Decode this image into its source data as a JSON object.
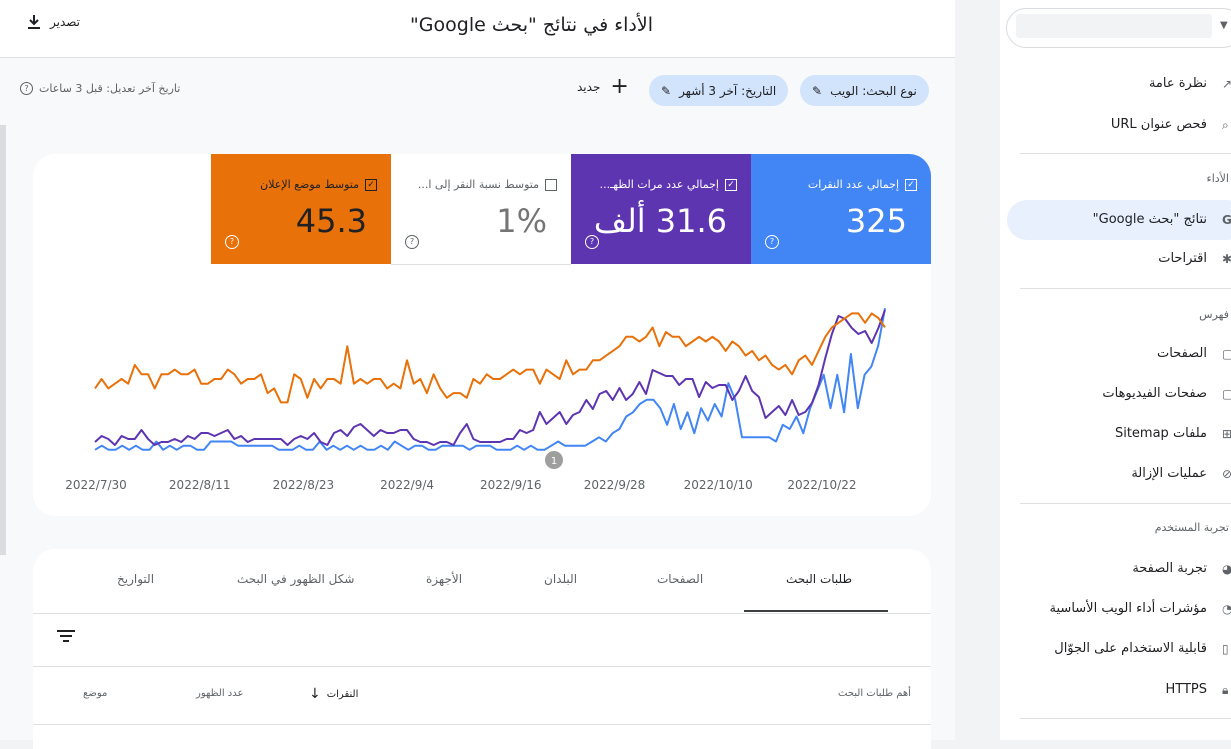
{
  "sidebar": {
    "items": [
      {
        "label": "نظرة عامة",
        "icon": "trend-icon"
      },
      {
        "label": "فحص عنوان URL",
        "icon": "search-icon"
      }
    ],
    "sections": [
      {
        "title": "الأداء",
        "items": [
          {
            "label": "نتائج \"بحث Google\"",
            "icon": "google-icon",
            "active": true
          },
          {
            "label": "اقتراحات",
            "icon": "asterisk-icon"
          }
        ]
      },
      {
        "title": "فهرس",
        "items": [
          {
            "label": "الصفحات",
            "icon": "pages-icon"
          },
          {
            "label": "صفحات الفيديوهات",
            "icon": "video-pages-icon"
          },
          {
            "label": "ملفات Sitemap",
            "icon": "sitemap-icon"
          },
          {
            "label": "عمليات الإزالة",
            "icon": "removal-icon"
          }
        ]
      },
      {
        "title": "تجربة المستخدم",
        "items": [
          {
            "label": "تجربة الصفحة",
            "icon": "page-experience-icon"
          },
          {
            "label": "مؤشرات أداء الويب الأساسية",
            "icon": "gauge-icon"
          },
          {
            "label": "قابلية الاستخدام على الجوّال",
            "icon": "mobile-icon"
          },
          {
            "label": "HTTPS",
            "icon": "lock-icon"
          }
        ]
      }
    ]
  },
  "header": {
    "title": "الأداء في نتائج \"بحث Google\"",
    "export_label": "تصدير"
  },
  "filters": {
    "search_type": "نوع البحث: الويب",
    "date": "التاريخ: آخر 3 أشهر",
    "new_label": "جديد",
    "last_updated": "تاريخ آخر تعديل: قبل 3 ساعات"
  },
  "metrics": [
    {
      "label": "إجمالي عدد النقرات",
      "value": "325",
      "checked": true,
      "color": "#4285f4"
    },
    {
      "label": "إجمالي عدد مرات الظهـ...",
      "value": "31.6 ألف",
      "checked": true,
      "color": "#5e35b1"
    },
    {
      "label": "متوسط نسبة النقر إلى ا...",
      "value": "1%",
      "checked": false,
      "color": "#ffffff"
    },
    {
      "label": "متوسط موضع الإعلان",
      "value": "45.3",
      "checked": true,
      "color": "#e8710a"
    }
  ],
  "annotation_marker": "1",
  "chart_data": {
    "type": "line",
    "x_ticks": [
      "2022/7/30",
      "2022/8/11",
      "2022/8/23",
      "2022/9/4",
      "2022/9/16",
      "2022/9/28",
      "2022/10/10",
      "2022/10/22"
    ],
    "series": [
      {
        "name": "إجمالي عدد النقرات",
        "color": "#4285f4",
        "values": [
          1,
          2,
          1,
          1,
          2,
          1,
          2,
          1,
          1,
          3,
          1,
          2,
          1,
          2,
          2,
          1,
          1,
          3,
          3,
          3,
          3,
          2,
          2,
          2,
          2,
          2,
          2,
          1,
          1,
          1,
          2,
          1,
          1,
          3,
          1,
          2,
          1,
          2,
          1,
          2,
          1,
          1,
          2,
          1,
          3,
          2,
          1,
          2,
          2,
          1,
          1,
          2,
          2,
          2,
          2,
          1,
          2,
          2,
          2,
          1,
          1,
          1,
          2,
          1,
          2,
          1,
          1,
          2,
          3,
          2,
          2,
          2,
          2,
          3,
          4,
          3,
          5,
          6,
          9,
          10,
          12,
          13,
          13,
          11,
          7,
          12,
          6,
          10,
          5,
          11,
          8,
          12,
          9,
          17,
          13,
          4,
          4,
          4,
          4,
          4,
          3,
          7,
          6,
          9,
          5,
          11,
          15,
          19,
          11,
          19,
          10,
          24,
          11,
          19,
          21,
          26,
          35
        ]
      },
      {
        "name": "إجمالي عدد مرات الظهـ...",
        "color": "#5e35b1",
        "values": [
          4,
          6,
          5,
          3,
          6,
          5,
          5,
          8,
          5,
          3,
          4,
          4,
          5,
          4,
          6,
          5,
          7,
          7,
          6,
          7,
          8,
          5,
          6,
          4,
          5,
          5,
          5,
          5,
          5,
          3,
          5,
          6,
          5,
          7,
          4,
          3,
          7,
          8,
          6,
          9,
          10,
          8,
          6,
          8,
          7,
          7,
          8,
          8,
          5,
          4,
          4,
          3,
          4,
          4,
          3,
          7,
          10,
          5,
          4,
          4,
          4,
          4,
          5,
          5,
          8,
          7,
          8,
          14,
          10,
          12,
          14,
          10,
          13,
          14,
          18,
          15,
          20,
          21,
          18,
          22,
          18,
          20,
          24,
          20,
          28,
          27,
          26,
          26,
          23,
          25,
          25,
          19,
          24,
          22,
          23,
          23,
          18,
          21,
          26,
          21,
          19,
          12,
          14,
          16,
          13,
          18,
          13,
          14,
          17,
          23,
          32,
          40,
          46,
          45,
          42,
          40,
          41,
          37,
          42,
          48
        ]
      },
      {
        "name": "متوسط موضع الإعلان",
        "color": "#e8710a",
        "values": [
          44,
          46,
          44,
          45,
          46,
          45,
          49,
          47,
          47,
          44,
          47,
          47,
          48,
          47,
          47,
          48,
          45,
          45,
          46,
          46,
          48,
          47,
          45,
          46,
          46,
          47,
          43,
          44,
          41,
          41,
          47,
          46,
          42,
          46,
          44,
          46,
          46,
          45,
          53,
          45,
          46,
          45,
          46,
          46,
          44,
          45,
          44,
          50,
          45,
          46,
          43,
          47,
          44,
          42,
          43,
          43,
          42,
          46,
          45,
          47,
          46,
          46,
          47,
          48,
          47,
          48,
          48,
          45,
          48,
          47,
          46,
          50,
          47,
          48,
          48,
          50,
          50,
          51,
          52,
          53,
          55,
          55,
          54,
          55,
          57,
          53,
          56,
          55,
          55,
          53,
          54,
          55,
          54,
          55,
          54,
          52,
          54,
          53,
          51,
          52,
          50,
          51,
          49,
          48,
          49,
          47,
          50,
          51,
          49,
          52,
          55,
          57,
          58,
          59,
          60,
          60,
          58,
          60,
          59,
          57
        ]
      }
    ],
    "xlabel": "",
    "ylabel": "",
    "grid": false,
    "legend": "none"
  },
  "tabs": [
    {
      "label": "طلبات البحث",
      "active": true
    },
    {
      "label": "الصفحات"
    },
    {
      "label": "البلدان"
    },
    {
      "label": "الأجهزة"
    },
    {
      "label": "شكل الظهور في البحث"
    },
    {
      "label": "التواريخ"
    }
  ],
  "table": {
    "query_header": "أهم طلبات البحث",
    "clicks_header": "النقرات",
    "impressions_header": "عدد الظهور",
    "position_header": "موضع"
  }
}
